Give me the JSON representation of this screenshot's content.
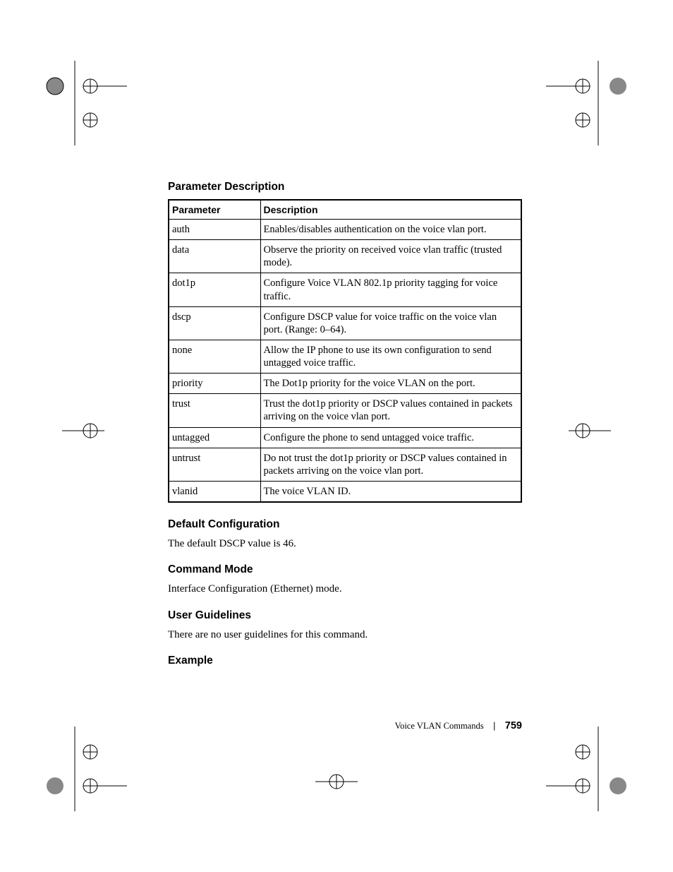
{
  "sections": {
    "param_desc_head": "Parameter Description",
    "default_cfg_head": "Default Configuration",
    "default_cfg_body": "The default DSCP value is 46.",
    "cmd_mode_head": "Command Mode",
    "cmd_mode_body": "Interface Configuration (Ethernet) mode.",
    "user_guide_head": "User Guidelines",
    "user_guide_body": "There are no user guidelines for this command.",
    "example_head": "Example"
  },
  "table": {
    "head": {
      "param": "Parameter",
      "desc": "Description"
    },
    "rows": [
      {
        "param": "auth",
        "desc": "Enables/disables authentication on the voice vlan port."
      },
      {
        "param": "data",
        "desc": "Observe the priority on received voice vlan traffic (trusted mode)."
      },
      {
        "param": "dot1p",
        "desc": "Configure Voice VLAN 802.1p priority tagging for voice traffic."
      },
      {
        "param": "dscp",
        "desc": "Configure DSCP value for voice traffic on the voice vlan port. (Range: 0–64)."
      },
      {
        "param": "none",
        "desc": "Allow the IP phone to use its own configuration to send untagged voice traffic."
      },
      {
        "param": "priority",
        "desc": "The Dot1p priority for the voice VLAN on the port."
      },
      {
        "param": "trust",
        "desc": "Trust the dot1p priority or DSCP values contained in packets arriving on the voice vlan port."
      },
      {
        "param": "untagged",
        "desc": "Configure the phone to send untagged voice traffic."
      },
      {
        "param": "untrust",
        "desc": "Do not trust the dot1p priority or DSCP values contained in packets arriving on the voice vlan port."
      },
      {
        "param": "vlanid",
        "desc": "The voice VLAN ID."
      }
    ]
  },
  "footer": {
    "chapter": "Voice VLAN Commands",
    "sep": "|",
    "page": "759"
  }
}
